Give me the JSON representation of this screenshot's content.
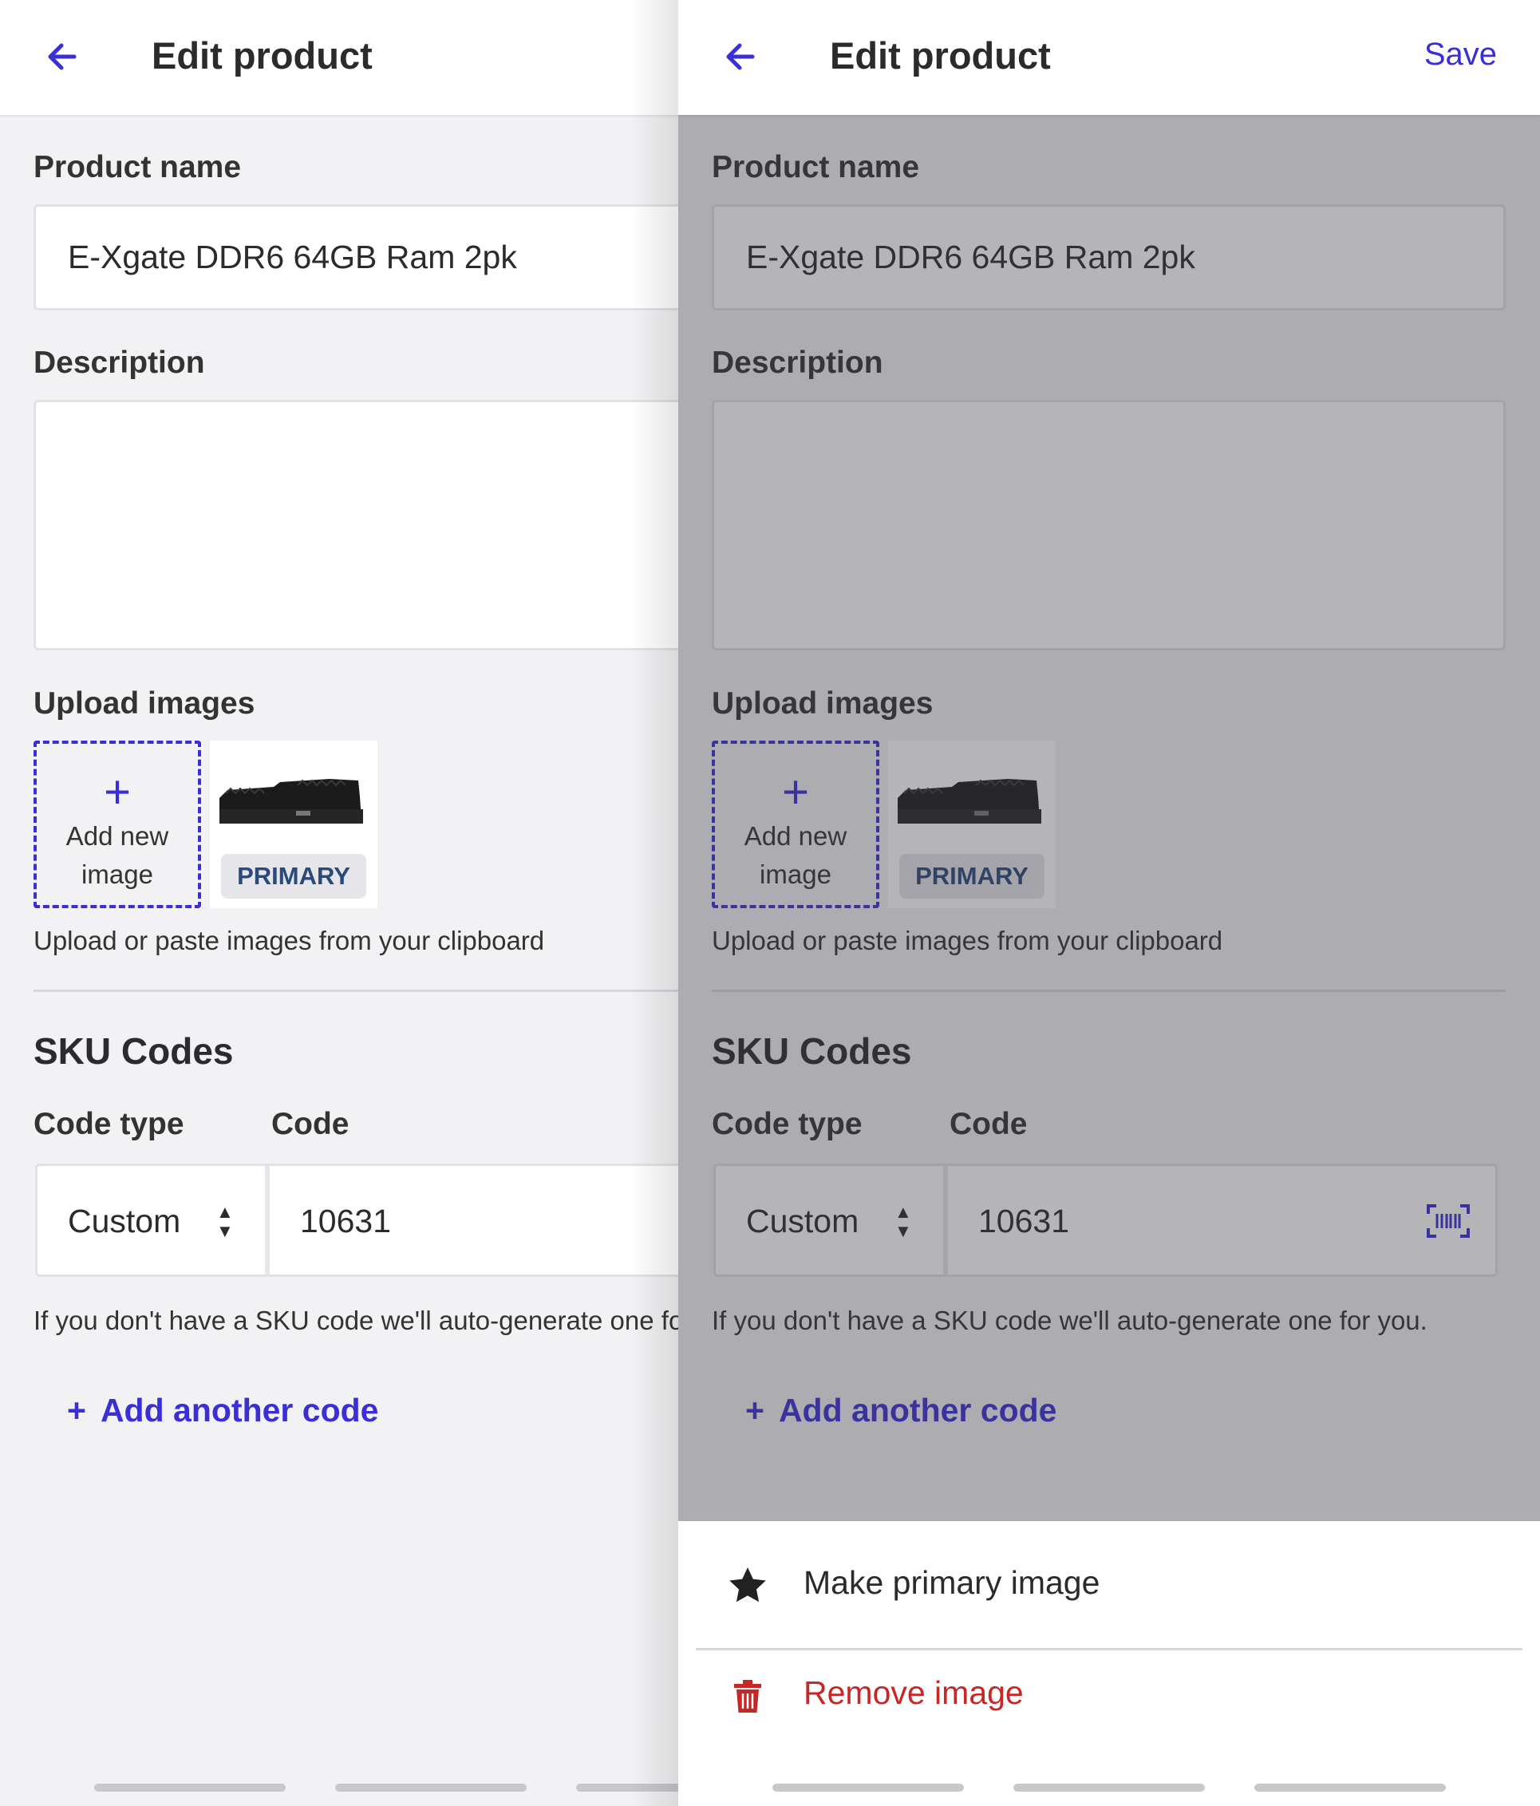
{
  "colors": {
    "accent": "#3a2fd6",
    "danger": "#c62828",
    "text": "#2b2b2e",
    "background": "#f2f2f4"
  },
  "header": {
    "title": "Edit product",
    "save_label": "Save"
  },
  "form": {
    "product_name_label": "Product name",
    "product_name_value": "E-Xgate DDR6 64GB Ram 2pk",
    "description_label": "Description",
    "description_value": "",
    "upload_label": "Upload images",
    "add_image_plus": "+",
    "add_image_line1": "Add new",
    "add_image_line2": "image",
    "primary_badge": "PRIMARY",
    "upload_hint": "Upload or paste images from your clipboard"
  },
  "sku": {
    "title": "SKU Codes",
    "code_type_label": "Code type",
    "code_label": "Code",
    "code_type_value": "Custom",
    "code_value": "10631",
    "hint": "If you don't have a SKU code we'll auto-generate one for you.",
    "add_another_label": "Add another code",
    "add_plus": "+"
  },
  "sheet": {
    "make_primary_label": "Make primary image",
    "remove_label": "Remove image"
  },
  "icons": [
    "back-arrow-icon",
    "plus-icon",
    "sort-arrows-icon",
    "barcode-scan-icon",
    "star-icon",
    "trash-icon"
  ]
}
